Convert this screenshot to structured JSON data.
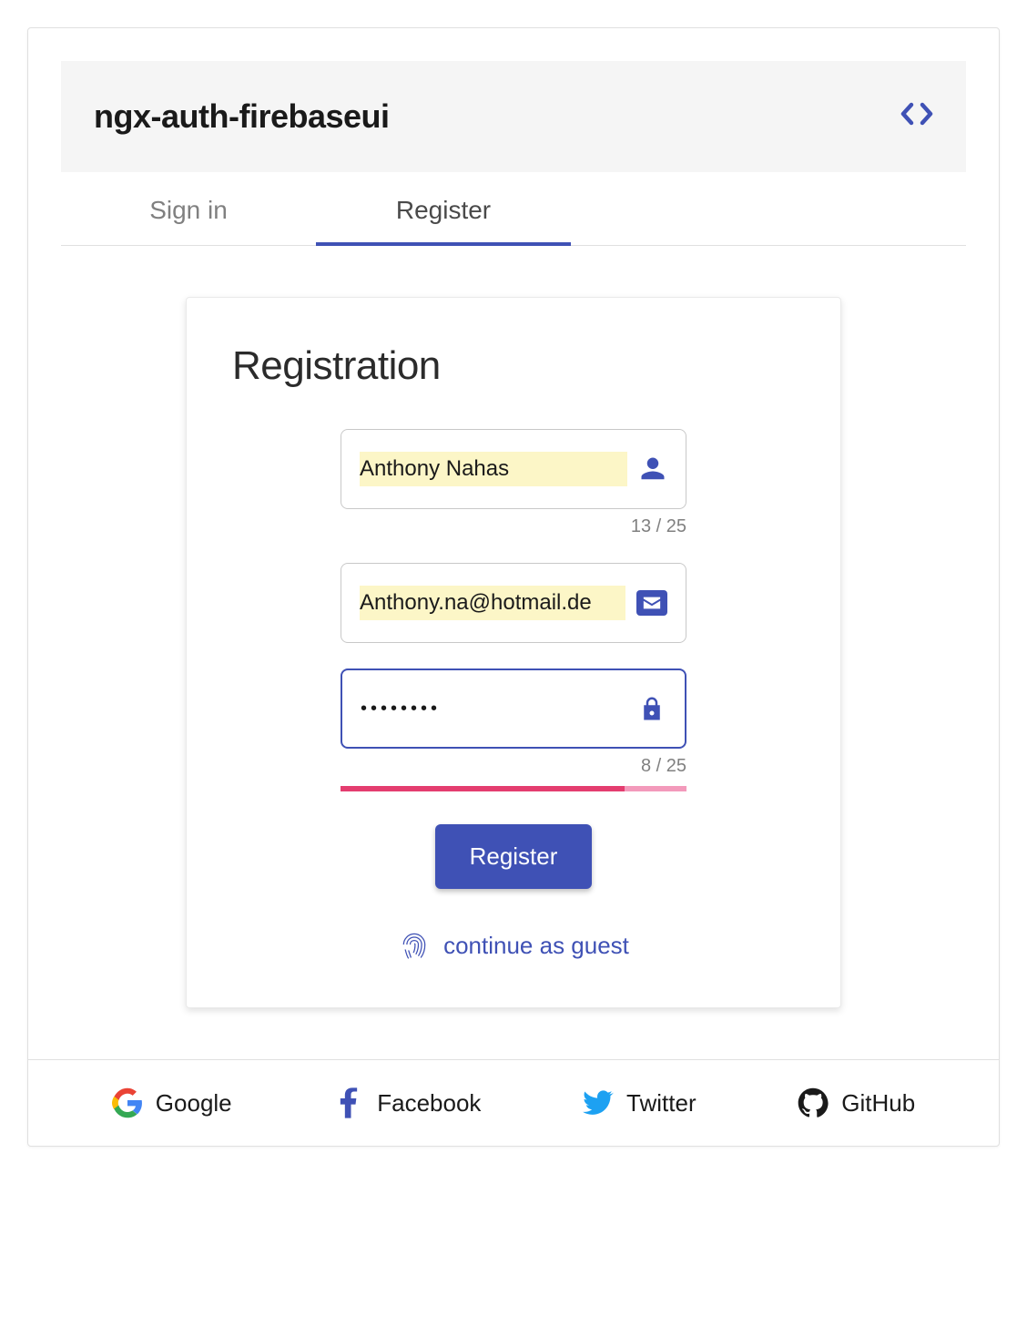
{
  "header": {
    "title": "ngx-auth-firebaseui"
  },
  "tabs": {
    "signin": "Sign in",
    "register": "Register",
    "active": "register"
  },
  "form": {
    "title": "Registration",
    "name_value": "Anthony Nahas",
    "name_counter": "13 / 25",
    "email_value": "Anthony.na@hotmail.de",
    "password_display": "••••••••",
    "password_counter": "8 / 25",
    "register_button": "Register",
    "guest_link": "continue as guest"
  },
  "providers": {
    "google": "Google",
    "facebook": "Facebook",
    "twitter": "Twitter",
    "github": "GitHub"
  }
}
